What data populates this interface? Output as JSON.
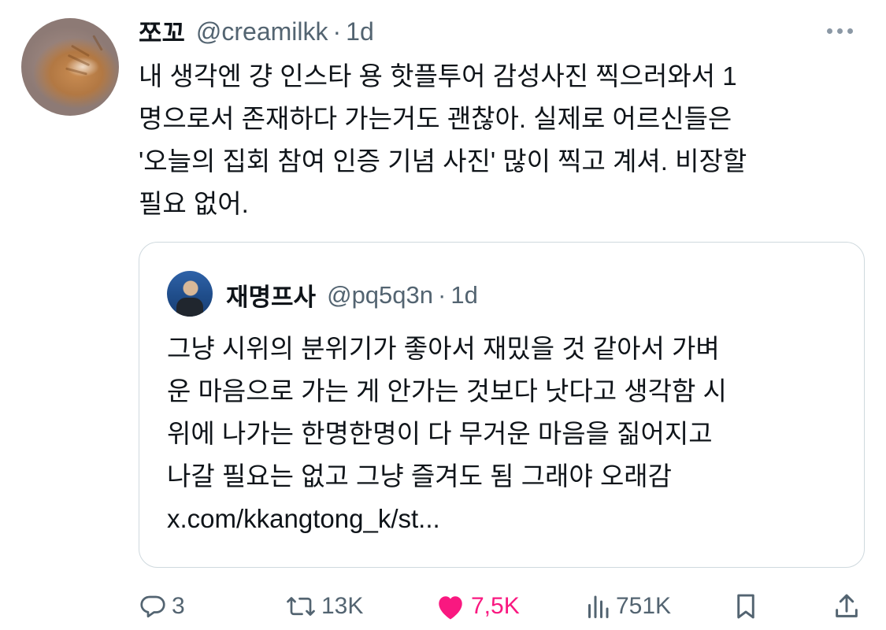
{
  "tweet": {
    "display_name": "쪼꼬",
    "handle": "@creamilkk",
    "separator": "·",
    "time": "1d",
    "text_lines": [
      "내 생각엔 걍 인스타 용 핫플투어 감성사진 찍으러와서 1",
      "명으로서 존재하다 가는거도 괜찮아. 실제로 어르신들은",
      "'오늘의 집회 참여 인증 기념 사진' 많이 찍고 계셔. 비장할",
      "필요 없어."
    ]
  },
  "quote": {
    "display_name": "재명프사",
    "handle": "@pq5q3n",
    "separator": "·",
    "time": "1d",
    "text_lines": [
      "그냥 시위의 분위기가 좋아서 재밌을 것 같아서 가벼",
      "운 마음으로 가는 게 안가는 것보다 낫다고 생각함 시",
      "위에 나가는 한명한명이 다 무거운 마음을 짊어지고",
      "나갈 필요는 없고 그냥 즐겨도 됨 그래야 오래감",
      "x.com/kkangtong_k/st..."
    ]
  },
  "actions": {
    "reply_count": "3",
    "retweet_count": "13K",
    "like_count": "7,5K",
    "views_count": "751K"
  },
  "colors": {
    "text_primary": "#0f1419",
    "text_secondary": "#536471",
    "like_pink": "#f91880",
    "border": "#cfd9de"
  },
  "icons": [
    "more-icon",
    "reply-icon",
    "retweet-icon",
    "heart-icon",
    "views-icon",
    "bookmark-icon",
    "share-icon"
  ]
}
